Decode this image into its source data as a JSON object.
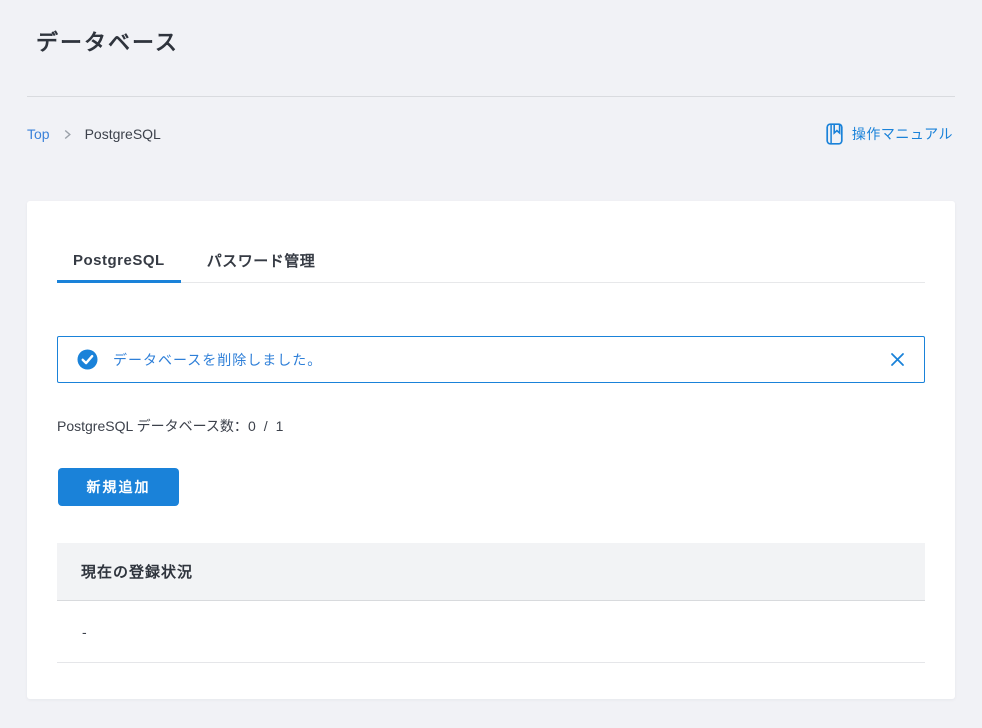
{
  "page": {
    "title": "データベース"
  },
  "breadcrumb": {
    "items": [
      {
        "label": "Top"
      },
      {
        "label": "PostgreSQL"
      }
    ]
  },
  "manual": {
    "label": "操作マニュアル"
  },
  "tabs": [
    {
      "label": "PostgreSQL",
      "active": true
    },
    {
      "label": "パスワード管理",
      "active": false
    }
  ],
  "alert": {
    "message": "データベースを削除しました。"
  },
  "db_count": {
    "label": "PostgreSQL データベース数：",
    "current": "0",
    "separator": "/",
    "limit": "1"
  },
  "buttons": {
    "add_new": "新規追加"
  },
  "table": {
    "header": "現在の登録状況",
    "rows": [
      {
        "value": "-"
      }
    ]
  },
  "colors": {
    "accent": "#1a82d9",
    "page_background": "#f1f2f6",
    "alert_text": "#2e7fd8",
    "table_header_background": "#f2f3f5"
  },
  "icons": {
    "manual": "manual-book-icon",
    "alert_status": "check-circle-icon",
    "alert_close": "close-icon",
    "breadcrumb_separator": "chevron-right-icon"
  }
}
